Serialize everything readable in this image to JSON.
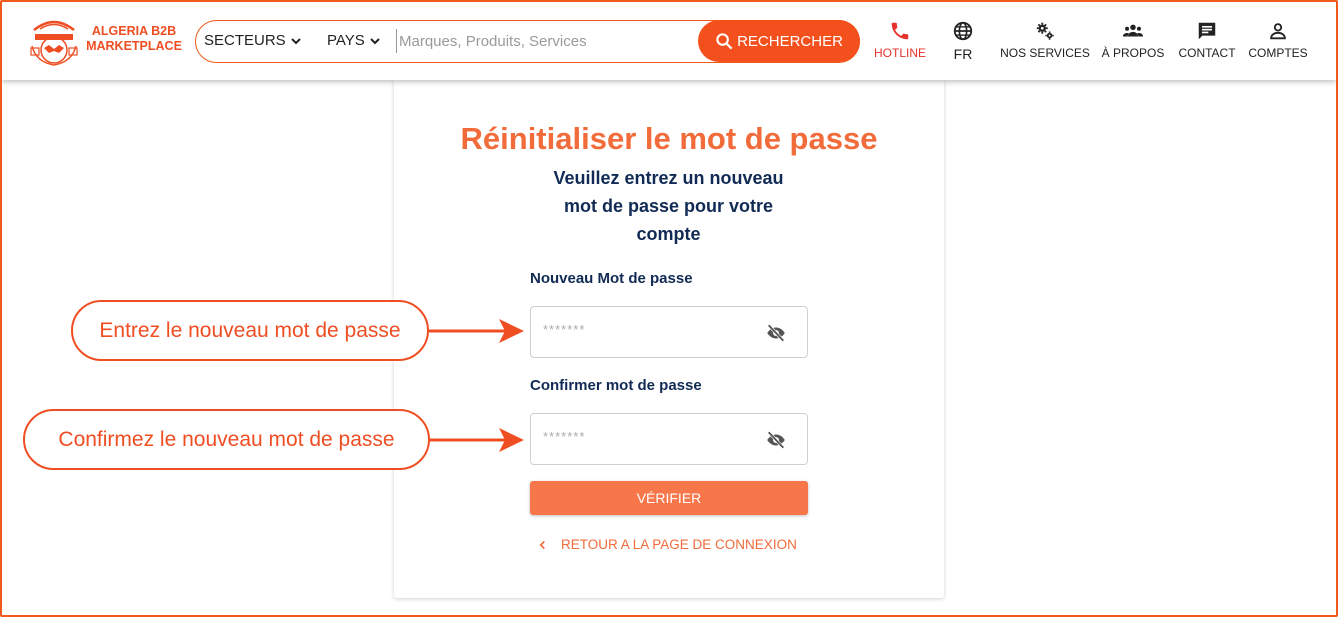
{
  "header": {
    "brand_line1": "ALGERIA B2B",
    "brand_line2": "MARKETPLACE",
    "logo_icon": "tenacious-globe-logo"
  },
  "search": {
    "sectors_label": "SECTEURS",
    "countries_label": "PAYS",
    "placeholder": "Marques, Produits, Services",
    "button_label": "RECHERCHER"
  },
  "nav": {
    "hotline": "HOTLINE",
    "language": "FR",
    "services": "NOS SERVICES",
    "about": "À PROPOS",
    "contact": "CONTACT",
    "accounts": "COMPTES"
  },
  "form": {
    "title": "Réinitialiser le mot de passe",
    "subtitle_line1": "Veuillez entrez un nouveau",
    "subtitle_line2": "mot de passe pour votre",
    "subtitle_line3": "compte",
    "new_password_label": "Nouveau Mot de passe",
    "new_password_value": "*******",
    "confirm_password_label": "Confirmer mot de passe",
    "confirm_password_value": "*******",
    "verify_button": "VÉRIFIER",
    "back_link": "RETOUR A LA PAGE DE CONNEXION"
  },
  "annotations": {
    "callout1": "Entrez le nouveau mot de passe",
    "callout2": "Confirmez le nouveau mot de passe"
  },
  "colors": {
    "accent": "#f4501e",
    "title": "#f26b3a",
    "navy": "#112b55",
    "hotline": "#e5322a"
  }
}
